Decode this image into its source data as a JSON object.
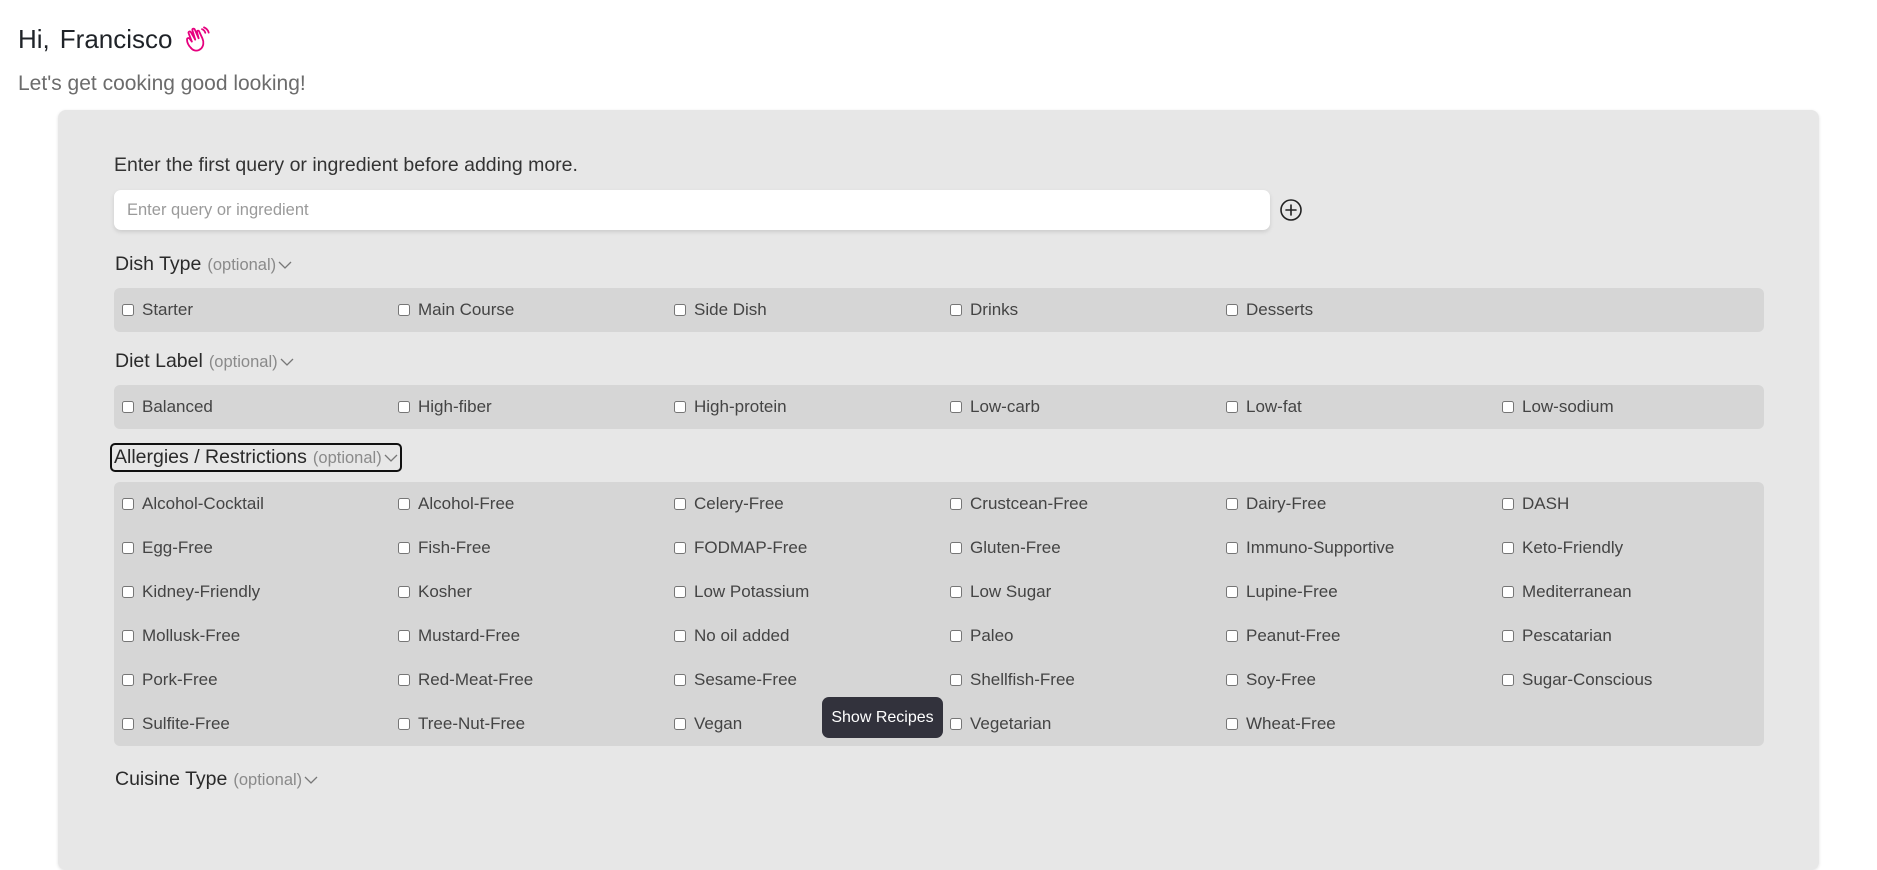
{
  "greeting": {
    "hi": "Hi,",
    "name": "Francisco",
    "emoji_icon": "waving-hand-icon"
  },
  "subtitle": "Let's get cooking good looking!",
  "search": {
    "prompt": "Enter the first query or ingredient before adding more.",
    "placeholder": "Enter query or ingredient",
    "value": ""
  },
  "sections": {
    "dish_type": {
      "title": "Dish Type",
      "optional": "(optional)"
    },
    "diet_label": {
      "title": "Diet Label",
      "optional": "(optional)"
    },
    "allergies": {
      "title": "Allergies / Restrictions",
      "optional": "(optional)"
    },
    "cuisine_type": {
      "title": "Cuisine Type",
      "optional": "(optional)"
    }
  },
  "dish_types": [
    "Starter",
    "Main Course",
    "Side Dish",
    "Drinks",
    "Desserts"
  ],
  "diet_labels": [
    "Balanced",
    "High-fiber",
    "High-protein",
    "Low-carb",
    "Low-fat",
    "Low-sodium"
  ],
  "allergies": [
    "Alcohol-Cocktail",
    "Alcohol-Free",
    "Celery-Free",
    "Crustcean-Free",
    "Dairy-Free",
    "DASH",
    "Egg-Free",
    "Fish-Free",
    "FODMAP-Free",
    "Gluten-Free",
    "Immuno-Supportive",
    "Keto-Friendly",
    "Kidney-Friendly",
    "Kosher",
    "Low Potassium",
    "Low Sugar",
    "Lupine-Free",
    "Mediterranean",
    "Mollusk-Free",
    "Mustard-Free",
    "No oil added",
    "Paleo",
    "Peanut-Free",
    "Pescatarian",
    "Pork-Free",
    "Red-Meat-Free",
    "Sesame-Free",
    "Shellfish-Free",
    "Soy-Free",
    "Sugar-Conscious",
    "Sulfite-Free",
    "Tree-Nut-Free",
    "Vegan",
    "Vegetarian",
    "Wheat-Free"
  ],
  "show_button": "Show Recipes",
  "colors": {
    "emoji": "#e6007e",
    "panel": "#e7e7e7",
    "group": "#d6d6d6",
    "button": "#32323c"
  }
}
